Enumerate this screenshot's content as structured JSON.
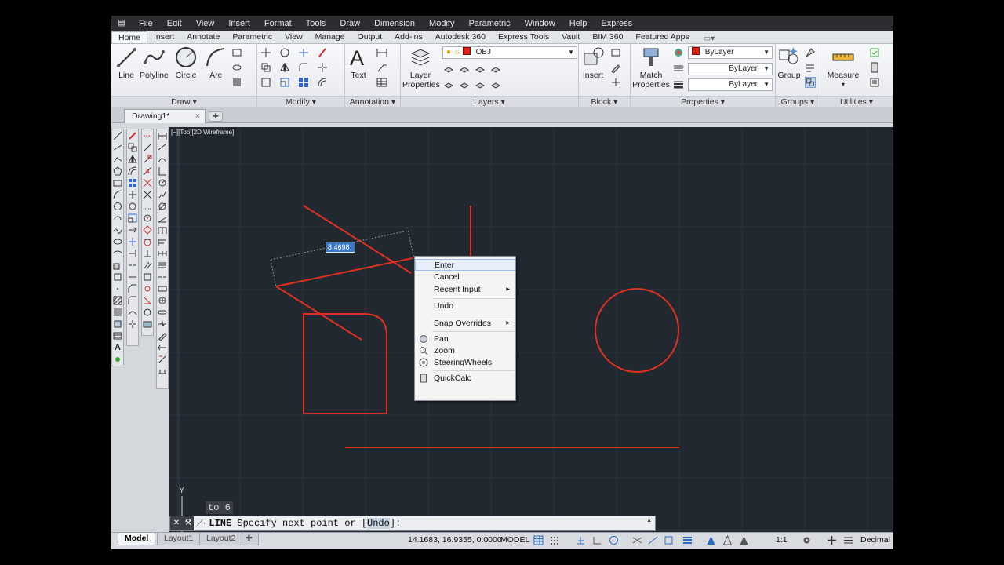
{
  "menubar": {
    "items": [
      "File",
      "Edit",
      "View",
      "Insert",
      "Format",
      "Tools",
      "Draw",
      "Dimension",
      "Modify",
      "Parametric",
      "Window",
      "Help",
      "Express"
    ]
  },
  "ribbon_tabs": [
    "Home",
    "Insert",
    "Annotate",
    "Parametric",
    "View",
    "Manage",
    "Output",
    "Add-ins",
    "Autodesk 360",
    "Express Tools",
    "Vault",
    "BIM 360",
    "Featured Apps"
  ],
  "ribbon": {
    "draw": {
      "title": "Draw",
      "line": "Line",
      "polyline": "Polyline",
      "circle": "Circle",
      "arc": "Arc"
    },
    "modify": {
      "title": "Modify"
    },
    "annotation": {
      "title": "Annotation",
      "text": "Text"
    },
    "layers": {
      "title": "Layers",
      "layer_properties_1": "Layer",
      "layer_properties_2": "Properties",
      "current_layer": "OBJ"
    },
    "block": {
      "title": "Block",
      "insert": "Insert"
    },
    "properties": {
      "title": "Properties",
      "match_1": "Match",
      "match_2": "Properties",
      "color": "ByLayer",
      "linetype": "ByLayer",
      "lineweight": "ByLayer"
    },
    "groups": {
      "title": "Groups",
      "group": "Group"
    },
    "utilities": {
      "title": "Utilities",
      "measure": "Measure"
    }
  },
  "doc_tabs": {
    "active": "Drawing1*",
    "close": "×"
  },
  "viewport": {
    "label": "[−][Top][2D Wireframe]",
    "y_axis": "Y"
  },
  "dynamic_input": {
    "length": "8.4698",
    "hint": "to 6"
  },
  "context_menu": {
    "enter": "Enter",
    "cancel": "Cancel",
    "recent_input": "Recent Input",
    "undo": "Undo",
    "snap_overrides": "Snap Overrides",
    "pan": "Pan",
    "zoom": "Zoom",
    "steering_wheels": "SteeringWheels",
    "quickcalc": "QuickCalc"
  },
  "command_line": {
    "command": "LINE",
    "prompt": "Specify next point or [",
    "option": "Undo",
    "end": "]:"
  },
  "status_bar": {
    "layout_tabs": [
      "Model",
      "Layout1",
      "Layout2"
    ],
    "coords": "14.1683, 16.9355, 0.0000",
    "space": "MODEL",
    "scale": "1:1",
    "units": "Decimal"
  },
  "colors": {
    "geometry": "#e0301e",
    "canvas": "#212830",
    "menubar": "#2b2d31",
    "highlight": "#3a78c9"
  }
}
